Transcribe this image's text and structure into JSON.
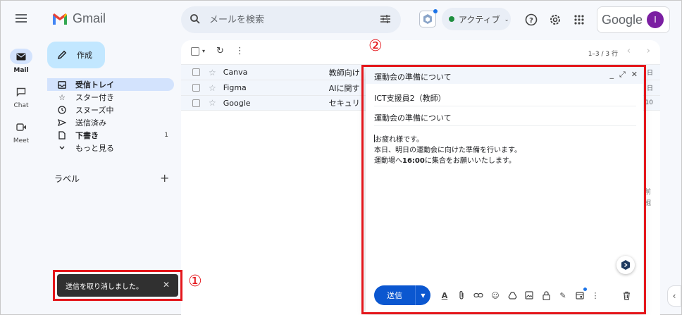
{
  "app": {
    "name": "Gmail",
    "brand_color": "#c5221f"
  },
  "header": {
    "search_placeholder": "メールを検索",
    "status_label": "アクティブ",
    "google_label": "Google",
    "avatar_initial": "I"
  },
  "rail": {
    "items": [
      {
        "label": "Mail",
        "icon": "mail-icon"
      },
      {
        "label": "Chat",
        "icon": "chat-icon"
      },
      {
        "label": "Meet",
        "icon": "video-icon"
      }
    ]
  },
  "sidebar": {
    "compose_label": "作成",
    "items": [
      {
        "label": "受信トレイ",
        "icon": "inbox-icon",
        "active": true,
        "count": ""
      },
      {
        "label": "スター付き",
        "icon": "star-icon",
        "count": ""
      },
      {
        "label": "スヌーズ中",
        "icon": "clock-icon",
        "count": ""
      },
      {
        "label": "送信済み",
        "icon": "send-icon",
        "count": ""
      },
      {
        "label": "下書き",
        "icon": "draft-icon",
        "count": "1",
        "bold": true
      },
      {
        "label": "もっと見る",
        "icon": "chevron-down-icon",
        "count": ""
      }
    ],
    "labels_title": "ラベル",
    "labels_add": "+"
  },
  "list": {
    "pager": "1–3 / 3 行",
    "rows": [
      {
        "sender": "Canva",
        "subject": "教師向け",
        "date": "日"
      },
      {
        "sender": "Figma",
        "subject": "AIに関す",
        "date": "日"
      },
      {
        "sender": "Google",
        "subject": "セキュリ",
        "date": "10"
      }
    ],
    "side_text_1": "前",
    "side_text_2": "掘"
  },
  "compose_window": {
    "title": "運動会の準備について",
    "to": "ICT支援員2（教師）",
    "subject": "運動会の準備について",
    "body": {
      "line1": "お疲れ様です。",
      "line2": "本日、明日の運動会に向けた準備を行います。",
      "line3_pre": "運動場へ",
      "line3_bold": "16:00",
      "line3_post": "に集合をお願いいたします。"
    },
    "send_label": "送信"
  },
  "snackbar": {
    "message": "送信を取り消しました。"
  },
  "annotations": {
    "marker1": "①",
    "marker2": "②",
    "color": "#e4161b"
  }
}
